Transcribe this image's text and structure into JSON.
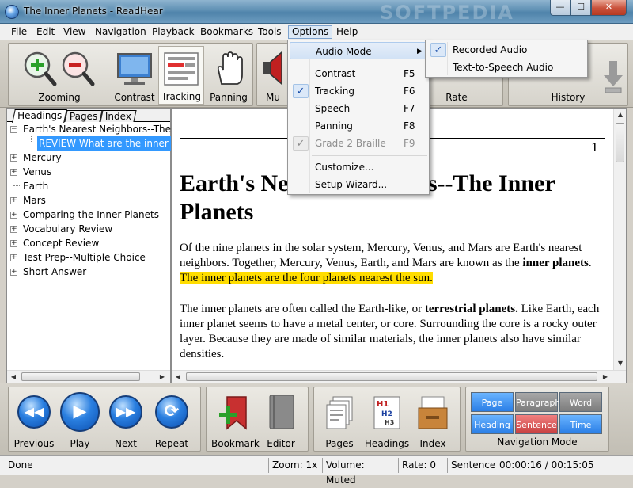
{
  "window": {
    "title": "The Inner Planets - ReadHear",
    "min": "—",
    "max": "☐",
    "close": "✕"
  },
  "menubar": [
    "File",
    "Edit",
    "View",
    "Navigation",
    "Playback",
    "Bookmarks",
    "Tools",
    "Options",
    "Help"
  ],
  "toolbar": {
    "zooming": "Zooming",
    "contrast": "Contrast",
    "tracking": "Tracking",
    "panning": "Panning",
    "mute": "Mu",
    "rate": "Rate",
    "history": "History"
  },
  "options_menu": {
    "audio_mode": "Audio Mode",
    "contrast": "Contrast",
    "contrast_key": "F5",
    "tracking": "Tracking",
    "tracking_key": "F6",
    "speech": "Speech",
    "speech_key": "F7",
    "panning": "Panning",
    "panning_key": "F8",
    "braille": "Grade 2 Braille",
    "braille_key": "F9",
    "customize": "Customize...",
    "setup_wizard": "Setup Wizard..."
  },
  "audio_submenu": {
    "recorded": "Recorded Audio",
    "tts": "Text-to-Speech Audio"
  },
  "tabs": [
    "Headings",
    "Pages",
    "Index"
  ],
  "tree": [
    {
      "label": "Earth's Nearest Neighbors--The Inr",
      "exp": "−"
    },
    {
      "label": "REVIEW What are the inner plar",
      "exp": ""
    },
    {
      "label": "Mercury",
      "exp": "+"
    },
    {
      "label": "Venus",
      "exp": "+"
    },
    {
      "label": "Earth",
      "exp": ""
    },
    {
      "label": "Mars",
      "exp": "+"
    },
    {
      "label": "Comparing the Inner Planets",
      "exp": "+"
    },
    {
      "label": "Vocabulary Review",
      "exp": "+"
    },
    {
      "label": "Concept Review",
      "exp": "+"
    },
    {
      "label": "Test Prep--Multiple Choice",
      "exp": "+"
    },
    {
      "label": "Short Answer",
      "exp": "+"
    }
  ],
  "document": {
    "page_number": "1",
    "heading_left": "Earth's Ne",
    "heading_right": "ors--The Inner",
    "heading_line2": "Planets",
    "p1_a": "Of the nine planets in the solar system, Mercury, Venus, and Mars are Earth's nearest neighbors. Together, Mercury, Venus, Earth, and Mars are known as the ",
    "p1_bold": "inner planets",
    "p1_b": ". ",
    "p1_highlight": "The inner planets are the four planets nearest the sun.",
    "p2_a": "The inner planets are often called the Earth-like, or ",
    "p2_bold": "terrestrial planets.",
    "p2_b": " Like Earth, each inner planet seems to have a metal center, or core. Surrounding the core is a rocky outer layer. Because they are made of similar materials, the inner planets also have similar densities."
  },
  "bottom": {
    "previous": "Previous",
    "play": "Play",
    "next": "Next",
    "repeat": "Repeat",
    "bookmark": "Bookmark",
    "editor": "Editor",
    "pages": "Pages",
    "headings": "Headings",
    "index": "Index",
    "nav_page": "Page",
    "nav_paragraph": "Paragraph",
    "nav_word": "Word",
    "nav_heading": "Heading",
    "nav_sentence": "Sentence",
    "nav_time": "Time",
    "nav_mode_label": "Navigation Mode"
  },
  "status": {
    "state": "Done",
    "zoom": "Zoom: 1x",
    "volume": "Volume: Muted",
    "rate": "Rate: 0",
    "unit": "Sentence",
    "time": "00:00:16 / 00:15:05"
  },
  "colors": {
    "highlight": "#ffdd00",
    "selection": "#3399ff",
    "accent": "#2a7ee6"
  },
  "watermark": "SOFTPEDIA"
}
